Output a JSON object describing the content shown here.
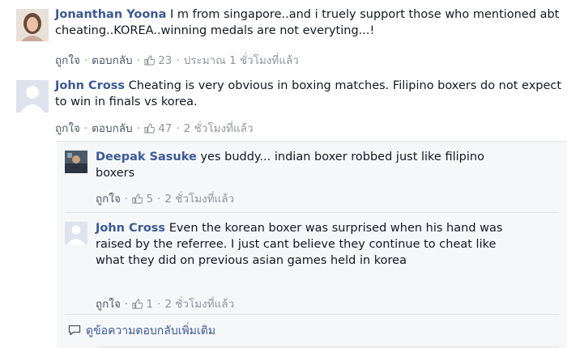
{
  "comments": [
    {
      "author": "Jonanthan Yoona",
      "text": "I m from singapore..and i truely support those who mentioned abt cheating..KOREA..winning medals are not everyting...!",
      "like_label": "ถูกใจ",
      "reply_label": "ตอบกลับ",
      "like_count": "23",
      "time": "ประมาณ 1 ชั่วโมงที่แล้ว",
      "avatar": "user-photo"
    },
    {
      "author": "John Cross",
      "text": "Cheating is very obvious in boxing matches. Filipino boxers do not expect to win in finals vs korea.",
      "like_label": "ถูกใจ",
      "reply_label": "ตอบกลับ",
      "like_count": "47",
      "time": "2 ชั่วโมงที่แล้ว",
      "avatar": "default-silhouette"
    }
  ],
  "replies": [
    {
      "author": "Deepak Sasuke",
      "text": "yes buddy... indian boxer robbed just like filipino boxers",
      "like_label": "ถูกใจ",
      "like_count": "5",
      "time": "2 ชั่วโมงที่แล้ว",
      "avatar": "user-photo"
    },
    {
      "author": "John Cross",
      "text": "Even the korean boxer was surprised when his hand was raised by the referree. I just cant believe they continue to cheat like what they did on previous asian games held in korea",
      "like_label": "ถูกใจ",
      "like_count": "1",
      "time": "2 ชั่วโมงที่แล้ว",
      "avatar": "default-silhouette"
    }
  ],
  "more_replies_label": "ดูข้อความตอบกลับเพิ่มเติม",
  "colors": {
    "link": "#3b5998",
    "meta": "#90949c",
    "reply_bg": "#f6f7f9"
  }
}
